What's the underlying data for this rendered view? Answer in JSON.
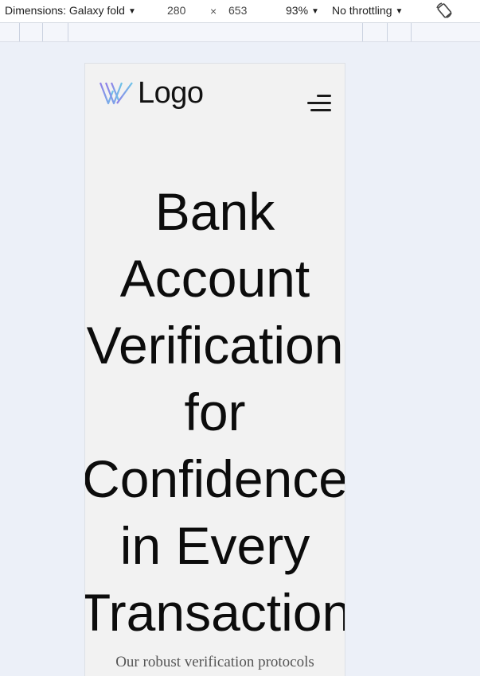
{
  "devtools": {
    "dimensions_label": "Dimensions: Galaxy fold",
    "width": "280",
    "times": "×",
    "height": "653",
    "zoom": "93%",
    "throttling": "No throttling",
    "dropdown_icon": "caret-down-icon",
    "rotate_icon": "rotate-icon"
  },
  "page": {
    "logo_text": "Logo",
    "logo_icon": "w-mark-icon",
    "menu_icon": "hamburger-icon",
    "headline_lines": [
      "Bank",
      "Account",
      "Verification",
      "for",
      "Confidence",
      "in Every",
      "Transaction"
    ],
    "subtext": "Our robust verification protocols"
  },
  "colors": {
    "canvas": "#ecf0f8",
    "page_bg": "#f2f2f2",
    "logo_gradient_start": "#8f7fe8",
    "logo_gradient_end": "#6ec3e8"
  }
}
